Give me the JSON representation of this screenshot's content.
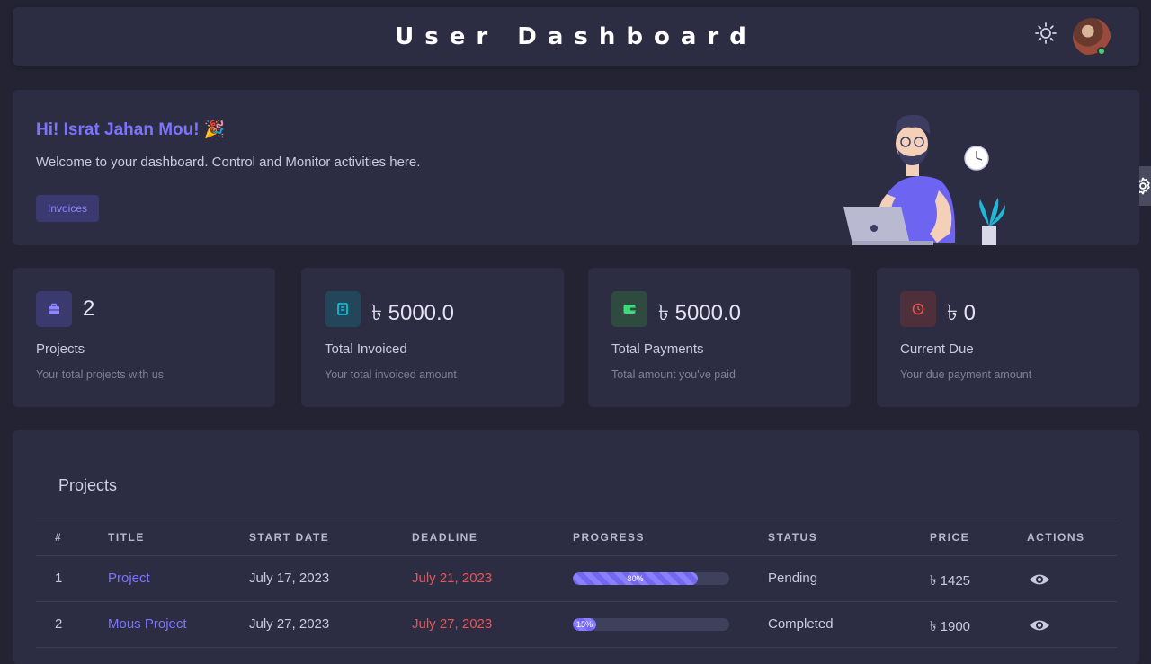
{
  "header": {
    "title": "User Dashboard",
    "theme_icon": "sun-icon",
    "avatar_status": "online"
  },
  "welcome": {
    "greeting": "Hi! Israt Jahan Mou! 🎉",
    "subtitle": "Welcome to your dashboard. Control and Monitor activities here.",
    "button_label": "Invoices"
  },
  "cards": [
    {
      "icon": "briefcase-icon",
      "value": "2",
      "label": "Projects",
      "desc": "Your total projects with us",
      "color": "#7367f0"
    },
    {
      "icon": "receipt-icon",
      "value": "৳ 5000.0",
      "label": "Total Invoiced",
      "desc": "Your total invoiced amount",
      "color": "#00cfe8"
    },
    {
      "icon": "wallet-icon",
      "value": "৳ 5000.0",
      "label": "Total Payments",
      "desc": "Total amount you've paid",
      "color": "#28c76f"
    },
    {
      "icon": "clock-icon",
      "value": "৳ 0",
      "label": "Current Due",
      "desc": "Your due payment amount",
      "color": "#ea5455"
    }
  ],
  "projects": {
    "title": "Projects",
    "columns": [
      "#",
      "TITLE",
      "START DATE",
      "DEADLINE",
      "PROGRESS",
      "STATUS",
      "PRICE",
      "ACTIONS"
    ],
    "rows": [
      {
        "num": "1",
        "title": "Project",
        "start": "July 17, 2023",
        "deadline": "July 21, 2023",
        "progress": 80,
        "progress_label": "80%",
        "status": "Pending",
        "price": "৳ 1425"
      },
      {
        "num": "2",
        "title": "Mous Project",
        "start": "July 27, 2023",
        "deadline": "July 27, 2023",
        "progress": 15,
        "progress_label": "15%",
        "status": "Completed",
        "price": "৳ 1900"
      }
    ]
  },
  "colors": {
    "accent": "#7367f0",
    "danger": "#ea5455",
    "card_bg": "#2c2d42",
    "page_bg": "#232333"
  }
}
